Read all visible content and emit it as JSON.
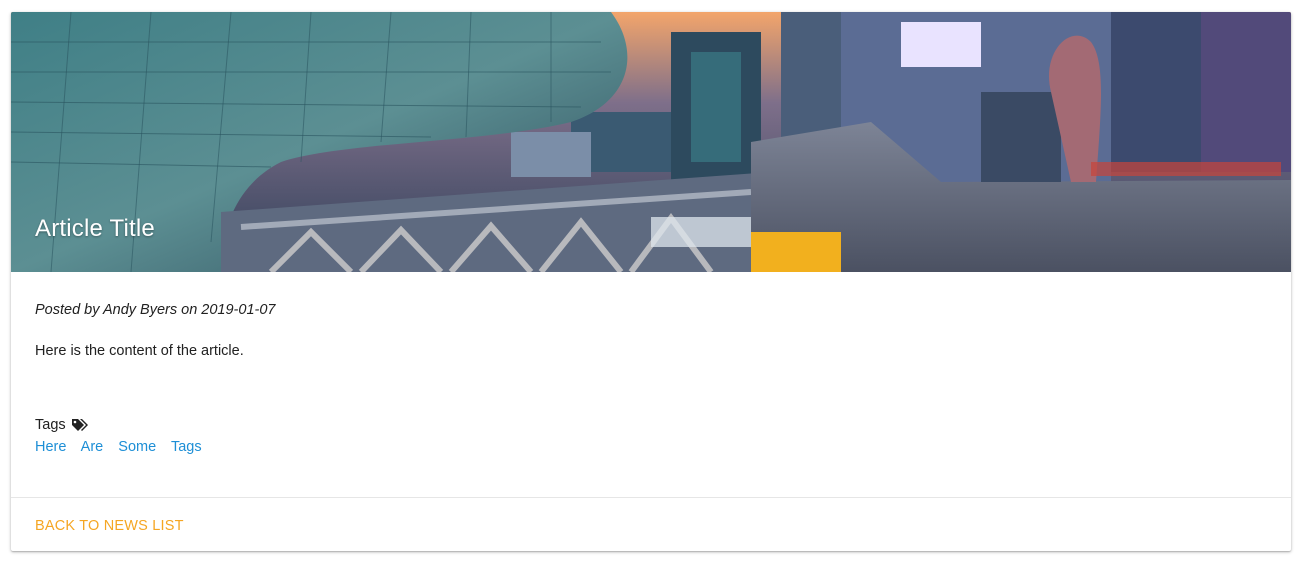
{
  "article": {
    "title": "Article Title",
    "posted_line": "Posted by Andy Byers on 2019-01-07",
    "content": "Here is the content of the article.",
    "tags_label": "Tags",
    "tags_icon": "tags-icon",
    "tags": [
      "Here",
      "Are",
      "Some",
      "Tags"
    ]
  },
  "actions": {
    "back_label": "BACK TO NEWS LIST"
  },
  "colors": {
    "link": "#1e8fd6",
    "accent": "#f5a623",
    "text": "#212121"
  }
}
